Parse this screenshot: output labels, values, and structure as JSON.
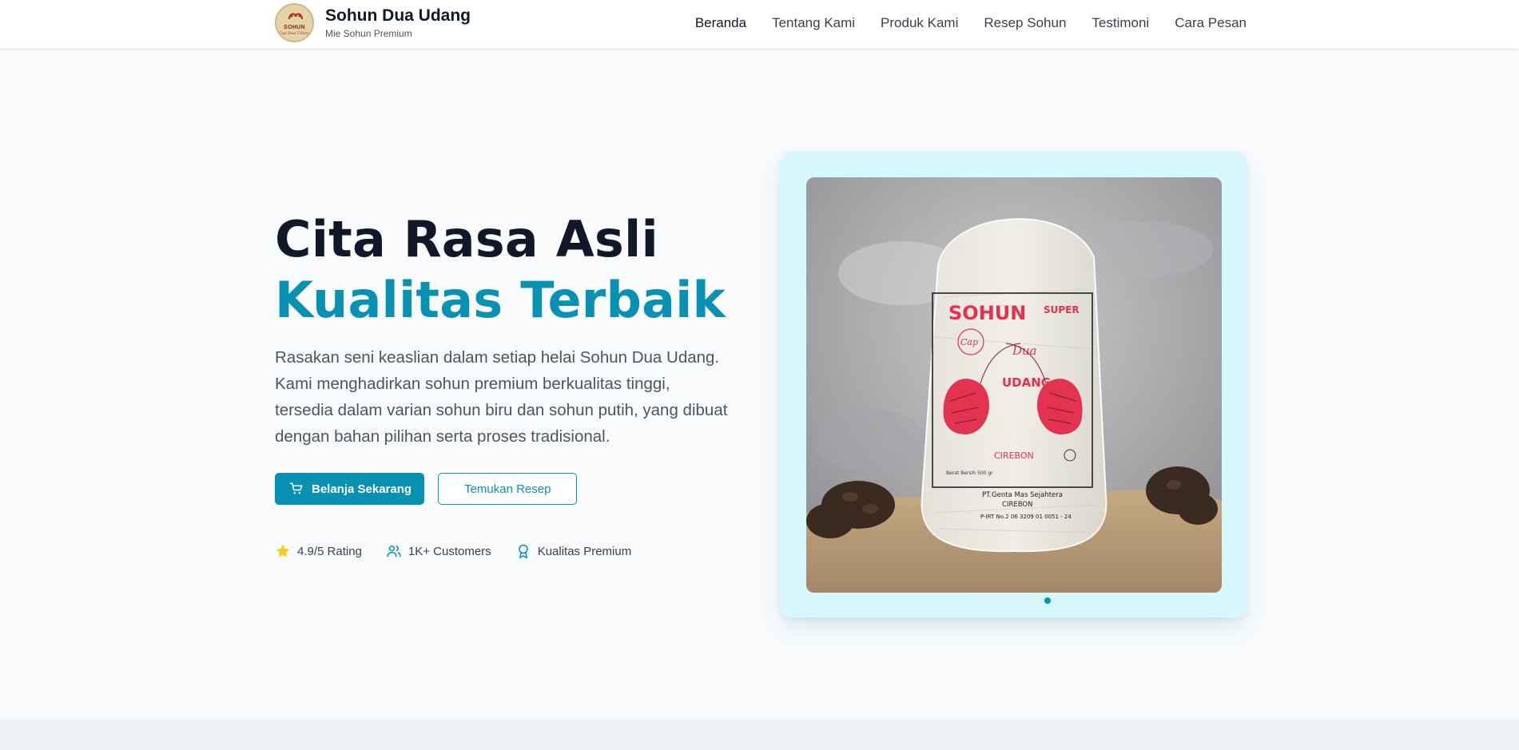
{
  "brand": {
    "name": "Sohun Dua Udang",
    "tagline": "Mie Sohun Premium",
    "logo_text": "SOHUN",
    "logo_sub": "Cap Dua Udang"
  },
  "nav": {
    "items": [
      "Beranda",
      "Tentang Kami",
      "Produk Kami",
      "Resep Sohun",
      "Testimoni",
      "Cara Pesan"
    ],
    "active": "Beranda"
  },
  "hero": {
    "title_line1": "Cita Rasa Asli",
    "title_line2": "Kualitas Terbaik",
    "description": "Rasakan seni keaslian dalam setiap helai Sohun Dua Udang. Kami menghadirkan sohun premium berkualitas tinggi, tersedia dalam varian sohun biru dan sohun putih, yang dibuat dengan bahan pilihan serta proses tradisional.",
    "primary_button": "Belanja Sekarang",
    "secondary_button": "Temukan Resep",
    "stats": [
      {
        "icon": "star-icon",
        "label": "4.9/5 Rating"
      },
      {
        "icon": "users-icon",
        "label": "1K+ Customers"
      },
      {
        "icon": "award-icon",
        "label": "Kualitas Premium"
      }
    ]
  },
  "product_photo": {
    "brand_text": "SOHUN",
    "super_text": "SUPER",
    "cap_text": "Cap",
    "dua_text": "Dua",
    "udang_text": "UDANG",
    "city_text": "CIREBON",
    "weight_text": "Berat Bersih 500 gr",
    "company_text": "PT.Genta Mas Sejahtera",
    "company_city": "CIREBON",
    "reg_text": "P-IRT No.2 06 3209 01 0051 - 24"
  },
  "carousel": {
    "total": 7,
    "active_index": 6
  },
  "colors": {
    "accent": "#0891b2",
    "card_bg": "#d6f7fb",
    "page_bg": "#f8fafc",
    "star": "#facc15"
  }
}
